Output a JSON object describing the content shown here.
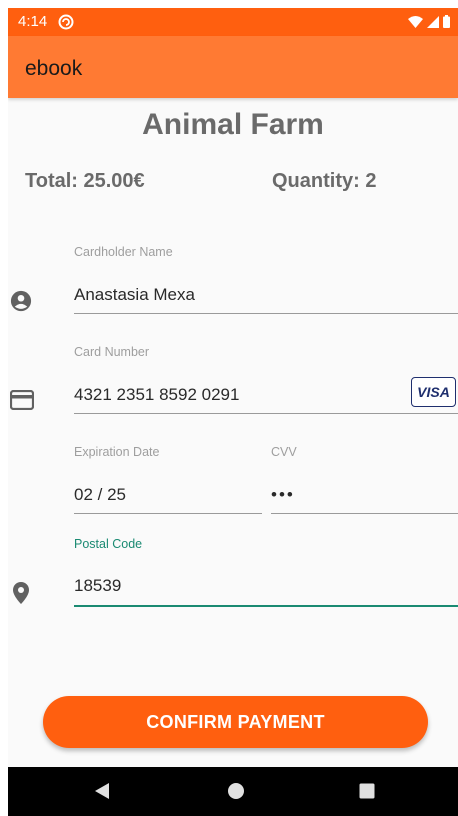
{
  "status_bar": {
    "time": "4:14"
  },
  "app_bar": {
    "title": "ebook"
  },
  "book": {
    "title": "Animal Farm"
  },
  "order": {
    "total": "Total: 25.00€",
    "quantity": "Quantity: 2"
  },
  "form": {
    "cardholder": {
      "label": "Cardholder Name",
      "value": "Anastasia Mexa"
    },
    "card_number": {
      "label": "Card Number",
      "value": "4321 2351 8592 0291",
      "brand": "VISA"
    },
    "expiration": {
      "label": "Expiration Date",
      "value": "02 / 25"
    },
    "cvv": {
      "label": "CVV",
      "value": "•••"
    },
    "postal_code": {
      "label": "Postal Code",
      "value": "18539"
    }
  },
  "actions": {
    "confirm_label": "CONFIRM PAYMENT"
  },
  "icons": {
    "cardholder": "account-circle-icon",
    "card": "credit-card-icon",
    "postal": "location-pin-icon",
    "nav_back": "back-triangle-icon",
    "nav_home": "home-circle-icon",
    "nav_recents": "recents-square-icon"
  },
  "colors": {
    "accent": "#ff5f0f",
    "app_bar": "#ff7a33",
    "focus": "#1a8a72",
    "visa": "#1f2f6e"
  }
}
